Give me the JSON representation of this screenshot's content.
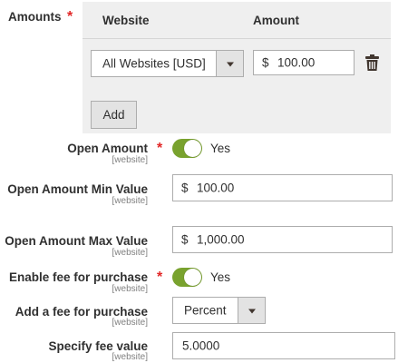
{
  "amounts": {
    "label": "Amounts",
    "required_mark": "*",
    "columns": {
      "website": "Website",
      "amount": "Amount"
    },
    "row": {
      "website_selected": "All Websites [USD]",
      "currency_symbol": "$",
      "amount_value": "100.00"
    },
    "add_label": "Add",
    "delete_icon": "trash-icon"
  },
  "fields": {
    "open_amount": {
      "label": "Open Amount",
      "scope": "[website]",
      "required_mark": "*",
      "toggle_text": "Yes",
      "enabled": true
    },
    "open_min": {
      "label": "Open Amount Min Value",
      "scope": "[website]",
      "currency_symbol": "$",
      "value": "100.00"
    },
    "open_max": {
      "label": "Open Amount Max Value",
      "scope": "[website]",
      "currency_symbol": "$",
      "value": "1,000.00"
    },
    "enable_fee": {
      "label": "Enable fee for purchase",
      "scope": "[website]",
      "required_mark": "*",
      "toggle_text": "Yes",
      "enabled": true
    },
    "add_fee": {
      "label": "Add a fee for purchase",
      "scope": "[website]",
      "selected": "Percent"
    },
    "fee_value": {
      "label": "Specify fee value",
      "scope": "[website]",
      "value": "5.0000"
    }
  },
  "colors": {
    "toggle_on": "#79a22e",
    "required": "#e22626",
    "grid_bg": "#efefef"
  }
}
